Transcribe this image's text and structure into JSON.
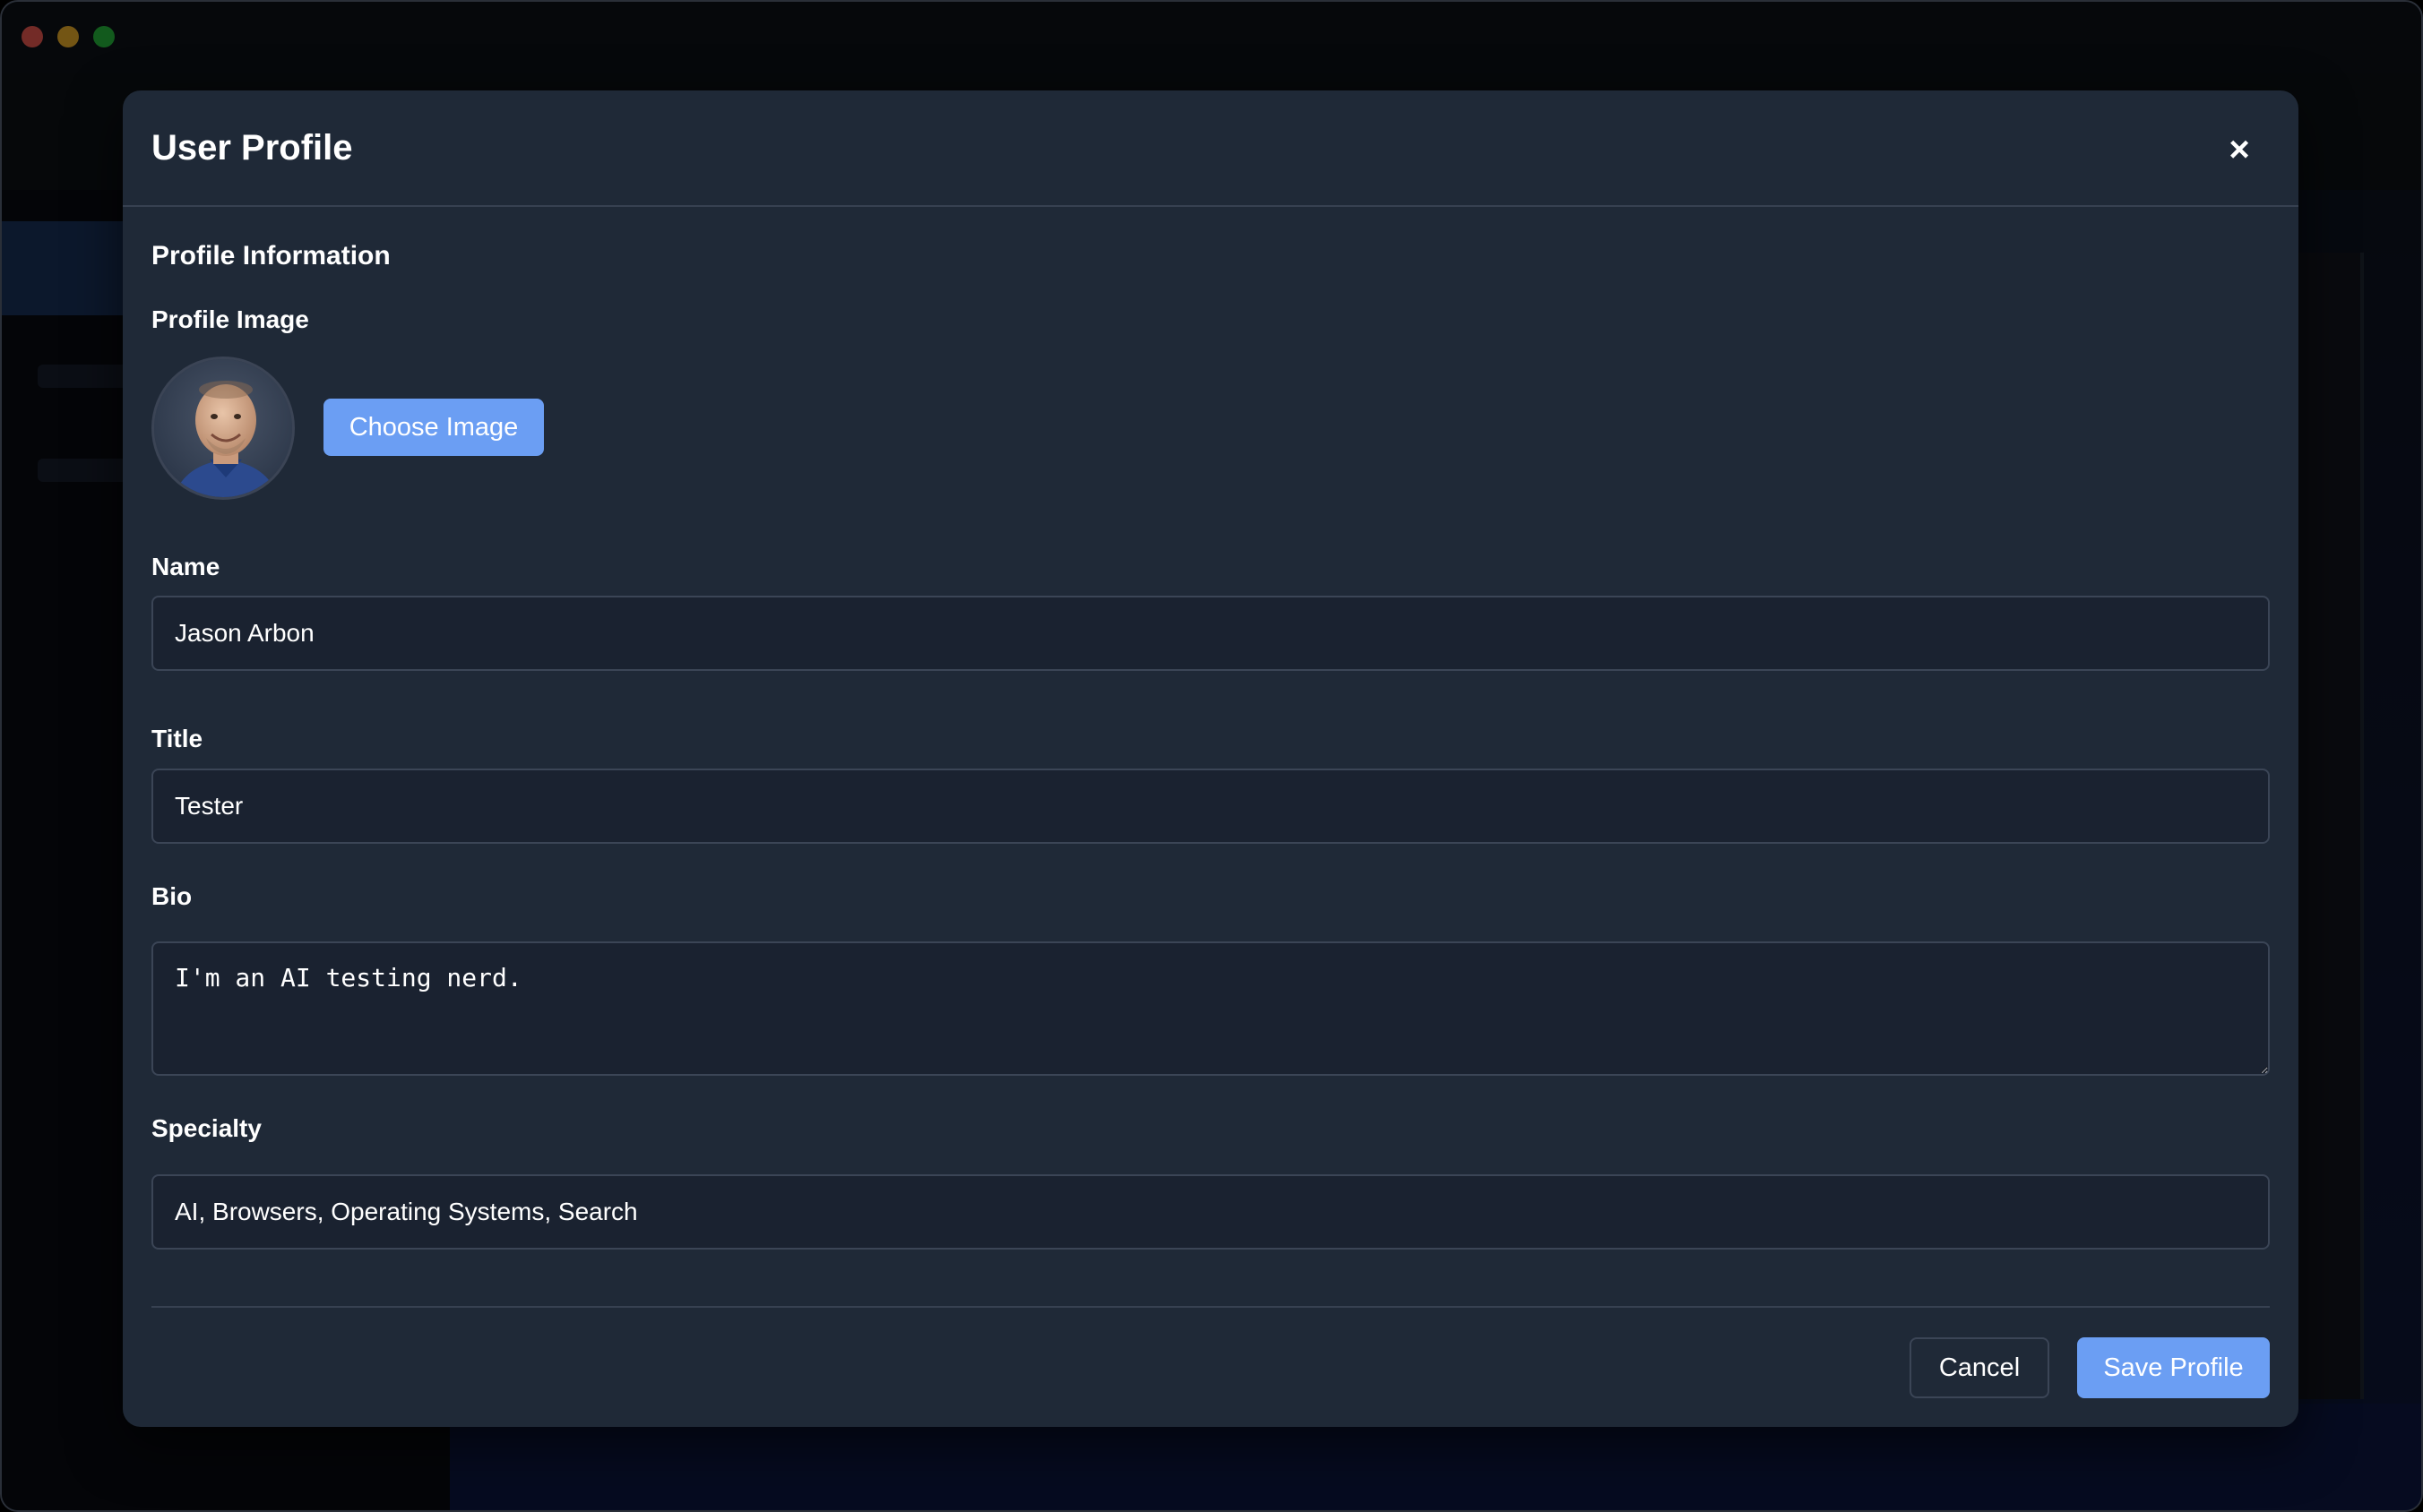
{
  "modal": {
    "title": "User Profile",
    "close_label": "×",
    "section_heading": "Profile Information",
    "profile_image_label": "Profile Image",
    "choose_image_label": "Choose Image",
    "name_label": "Name",
    "name_value": "Jason Arbon",
    "title_label": "Title",
    "title_value": "Tester",
    "bio_label": "Bio",
    "bio_value": "I'm an AI testing nerd.",
    "specialty_label": "Specialty",
    "specialty_value": "AI, Browsers, Operating Systems, Search",
    "cancel_label": "Cancel",
    "save_label": "Save Profile"
  },
  "colors": {
    "accent": "#6b9ef3",
    "modal_bg": "#1f2937",
    "input_bg": "#1a2230"
  },
  "icons": {
    "close": "close-icon",
    "avatar": "profile-avatar"
  }
}
